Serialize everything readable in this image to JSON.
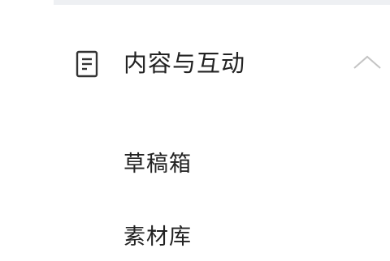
{
  "sidebar": {
    "group": {
      "label": "内容与互动",
      "icon": "document-icon",
      "expanded": true,
      "chevron": "chevron-up-icon"
    },
    "items": [
      {
        "label": "草稿箱"
      },
      {
        "label": "素材库"
      }
    ]
  },
  "colors": {
    "text": "#222222",
    "icon": "#333333",
    "chevron": "#c4c4c4",
    "divider": "#eef0f3",
    "background": "#ffffff"
  }
}
